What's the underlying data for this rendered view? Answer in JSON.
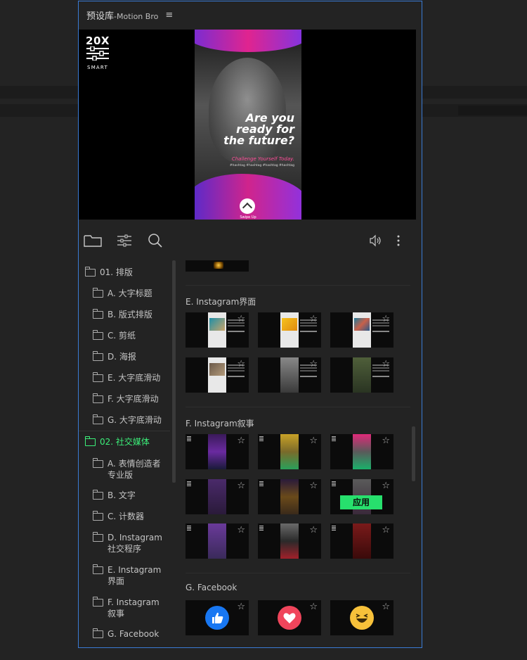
{
  "panel": {
    "title": "预设库",
    "subtitle": "-Motion Bro",
    "menu_icon": "hamburger-icon"
  },
  "preview": {
    "logo_big": "20X",
    "logo_small": "SMART",
    "headline": "Are you ready for the future?",
    "subline": "Challenge Yourself Today.",
    "hashtags": "#hashtag #hashtag #hashtag #hashtag",
    "swipe_label": "Swipe Up"
  },
  "toolbar": {
    "icons": [
      "folder-icon",
      "sliders-icon",
      "search-icon",
      "volume-icon",
      "more-vertical-icon"
    ]
  },
  "sidebar": {
    "items": [
      {
        "label": "01. 排版",
        "level": 0,
        "active": false
      },
      {
        "label": "A. 大字标题",
        "level": 1,
        "active": false
      },
      {
        "label": "B. 版式排版",
        "level": 1,
        "active": false
      },
      {
        "label": "C. 剪纸",
        "level": 1,
        "active": false
      },
      {
        "label": "D. 海报",
        "level": 1,
        "active": false
      },
      {
        "label": "E. 大字底滑动",
        "level": 1,
        "active": false
      },
      {
        "label": "F. 大字底滑动",
        "level": 1,
        "active": false
      },
      {
        "label": "G. 大字底滑动",
        "level": 1,
        "active": false
      },
      {
        "label": "02. 社交媒体",
        "level": 0,
        "active": true
      },
      {
        "label": "A. 表情创造者专业版",
        "level": 1,
        "active": false
      },
      {
        "label": "B. 文字",
        "level": 1,
        "active": false
      },
      {
        "label": "C. 计数器",
        "level": 1,
        "active": false
      },
      {
        "label": "D. Instagram社交程序",
        "level": 1,
        "active": false
      },
      {
        "label": "E. Instagram界面",
        "level": 1,
        "active": false
      },
      {
        "label": "F. Instagram叙事",
        "level": 1,
        "active": false
      },
      {
        "label": "G. Facebook",
        "level": 1,
        "active": false
      }
    ]
  },
  "content": {
    "sections": [
      {
        "title": "E. Instagram界面"
      },
      {
        "title": "F. Instagram叙事"
      },
      {
        "title": "G. Facebook"
      }
    ],
    "apply_label": "应用",
    "star_icon": "star-outline-icon",
    "facebook_reactions": [
      "like-icon",
      "heart-icon",
      "laugh-icon"
    ]
  },
  "colors": {
    "accent_blue": "#3a7bd5",
    "active_green": "#3cf07a",
    "apply_green": "#27e06d",
    "facebook_blue": "#1877f2",
    "love_red": "#f0455b",
    "haha_yellow": "#f7c13a"
  }
}
